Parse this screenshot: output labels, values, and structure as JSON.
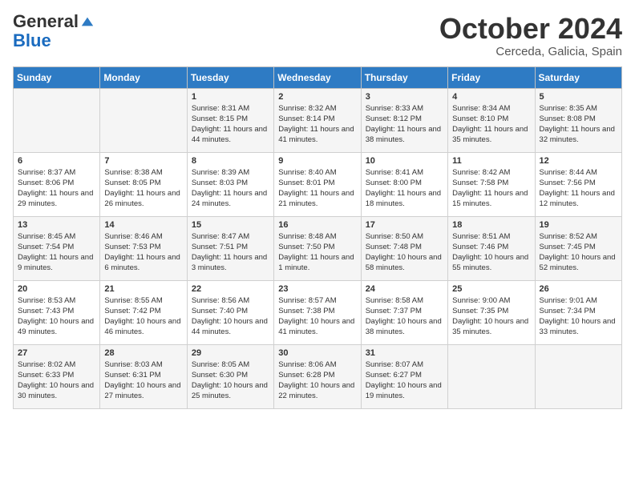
{
  "header": {
    "logo_general": "General",
    "logo_blue": "Blue",
    "month_title": "October 2024",
    "location": "Cerceda, Galicia, Spain"
  },
  "weekdays": [
    "Sunday",
    "Monday",
    "Tuesday",
    "Wednesday",
    "Thursday",
    "Friday",
    "Saturday"
  ],
  "weeks": [
    [
      {
        "day": "",
        "sunrise": "",
        "sunset": "",
        "daylight": ""
      },
      {
        "day": "",
        "sunrise": "",
        "sunset": "",
        "daylight": ""
      },
      {
        "day": "1",
        "sunrise": "Sunrise: 8:31 AM",
        "sunset": "Sunset: 8:15 PM",
        "daylight": "Daylight: 11 hours and 44 minutes."
      },
      {
        "day": "2",
        "sunrise": "Sunrise: 8:32 AM",
        "sunset": "Sunset: 8:14 PM",
        "daylight": "Daylight: 11 hours and 41 minutes."
      },
      {
        "day": "3",
        "sunrise": "Sunrise: 8:33 AM",
        "sunset": "Sunset: 8:12 PM",
        "daylight": "Daylight: 11 hours and 38 minutes."
      },
      {
        "day": "4",
        "sunrise": "Sunrise: 8:34 AM",
        "sunset": "Sunset: 8:10 PM",
        "daylight": "Daylight: 11 hours and 35 minutes."
      },
      {
        "day": "5",
        "sunrise": "Sunrise: 8:35 AM",
        "sunset": "Sunset: 8:08 PM",
        "daylight": "Daylight: 11 hours and 32 minutes."
      }
    ],
    [
      {
        "day": "6",
        "sunrise": "Sunrise: 8:37 AM",
        "sunset": "Sunset: 8:06 PM",
        "daylight": "Daylight: 11 hours and 29 minutes."
      },
      {
        "day": "7",
        "sunrise": "Sunrise: 8:38 AM",
        "sunset": "Sunset: 8:05 PM",
        "daylight": "Daylight: 11 hours and 26 minutes."
      },
      {
        "day": "8",
        "sunrise": "Sunrise: 8:39 AM",
        "sunset": "Sunset: 8:03 PM",
        "daylight": "Daylight: 11 hours and 24 minutes."
      },
      {
        "day": "9",
        "sunrise": "Sunrise: 8:40 AM",
        "sunset": "Sunset: 8:01 PM",
        "daylight": "Daylight: 11 hours and 21 minutes."
      },
      {
        "day": "10",
        "sunrise": "Sunrise: 8:41 AM",
        "sunset": "Sunset: 8:00 PM",
        "daylight": "Daylight: 11 hours and 18 minutes."
      },
      {
        "day": "11",
        "sunrise": "Sunrise: 8:42 AM",
        "sunset": "Sunset: 7:58 PM",
        "daylight": "Daylight: 11 hours and 15 minutes."
      },
      {
        "day": "12",
        "sunrise": "Sunrise: 8:44 AM",
        "sunset": "Sunset: 7:56 PM",
        "daylight": "Daylight: 11 hours and 12 minutes."
      }
    ],
    [
      {
        "day": "13",
        "sunrise": "Sunrise: 8:45 AM",
        "sunset": "Sunset: 7:54 PM",
        "daylight": "Daylight: 11 hours and 9 minutes."
      },
      {
        "day": "14",
        "sunrise": "Sunrise: 8:46 AM",
        "sunset": "Sunset: 7:53 PM",
        "daylight": "Daylight: 11 hours and 6 minutes."
      },
      {
        "day": "15",
        "sunrise": "Sunrise: 8:47 AM",
        "sunset": "Sunset: 7:51 PM",
        "daylight": "Daylight: 11 hours and 3 minutes."
      },
      {
        "day": "16",
        "sunrise": "Sunrise: 8:48 AM",
        "sunset": "Sunset: 7:50 PM",
        "daylight": "Daylight: 11 hours and 1 minute."
      },
      {
        "day": "17",
        "sunrise": "Sunrise: 8:50 AM",
        "sunset": "Sunset: 7:48 PM",
        "daylight": "Daylight: 10 hours and 58 minutes."
      },
      {
        "day": "18",
        "sunrise": "Sunrise: 8:51 AM",
        "sunset": "Sunset: 7:46 PM",
        "daylight": "Daylight: 10 hours and 55 minutes."
      },
      {
        "day": "19",
        "sunrise": "Sunrise: 8:52 AM",
        "sunset": "Sunset: 7:45 PM",
        "daylight": "Daylight: 10 hours and 52 minutes."
      }
    ],
    [
      {
        "day": "20",
        "sunrise": "Sunrise: 8:53 AM",
        "sunset": "Sunset: 7:43 PM",
        "daylight": "Daylight: 10 hours and 49 minutes."
      },
      {
        "day": "21",
        "sunrise": "Sunrise: 8:55 AM",
        "sunset": "Sunset: 7:42 PM",
        "daylight": "Daylight: 10 hours and 46 minutes."
      },
      {
        "day": "22",
        "sunrise": "Sunrise: 8:56 AM",
        "sunset": "Sunset: 7:40 PM",
        "daylight": "Daylight: 10 hours and 44 minutes."
      },
      {
        "day": "23",
        "sunrise": "Sunrise: 8:57 AM",
        "sunset": "Sunset: 7:38 PM",
        "daylight": "Daylight: 10 hours and 41 minutes."
      },
      {
        "day": "24",
        "sunrise": "Sunrise: 8:58 AM",
        "sunset": "Sunset: 7:37 PM",
        "daylight": "Daylight: 10 hours and 38 minutes."
      },
      {
        "day": "25",
        "sunrise": "Sunrise: 9:00 AM",
        "sunset": "Sunset: 7:35 PM",
        "daylight": "Daylight: 10 hours and 35 minutes."
      },
      {
        "day": "26",
        "sunrise": "Sunrise: 9:01 AM",
        "sunset": "Sunset: 7:34 PM",
        "daylight": "Daylight: 10 hours and 33 minutes."
      }
    ],
    [
      {
        "day": "27",
        "sunrise": "Sunrise: 8:02 AM",
        "sunset": "Sunset: 6:33 PM",
        "daylight": "Daylight: 10 hours and 30 minutes."
      },
      {
        "day": "28",
        "sunrise": "Sunrise: 8:03 AM",
        "sunset": "Sunset: 6:31 PM",
        "daylight": "Daylight: 10 hours and 27 minutes."
      },
      {
        "day": "29",
        "sunrise": "Sunrise: 8:05 AM",
        "sunset": "Sunset: 6:30 PM",
        "daylight": "Daylight: 10 hours and 25 minutes."
      },
      {
        "day": "30",
        "sunrise": "Sunrise: 8:06 AM",
        "sunset": "Sunset: 6:28 PM",
        "daylight": "Daylight: 10 hours and 22 minutes."
      },
      {
        "day": "31",
        "sunrise": "Sunrise: 8:07 AM",
        "sunset": "Sunset: 6:27 PM",
        "daylight": "Daylight: 10 hours and 19 minutes."
      },
      {
        "day": "",
        "sunrise": "",
        "sunset": "",
        "daylight": ""
      },
      {
        "day": "",
        "sunrise": "",
        "sunset": "",
        "daylight": ""
      }
    ]
  ]
}
